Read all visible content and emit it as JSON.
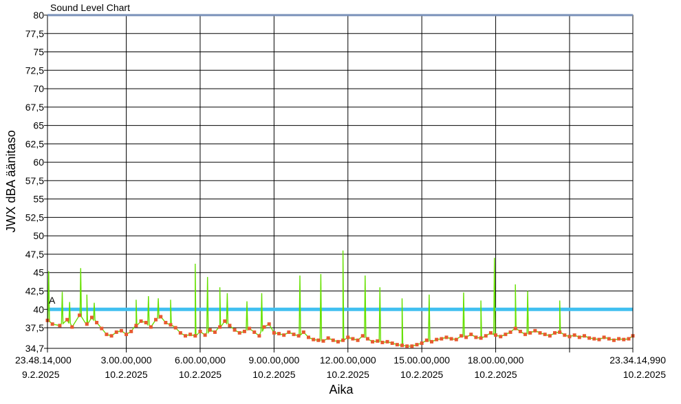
{
  "chart_data": {
    "type": "line",
    "title": "Sound Level Chart",
    "xlabel": "Aika",
    "ylabel": "JWX dBA äänitaso",
    "ylim": [
      34.7,
      80
    ],
    "y_ticks": [
      "80",
      "77,5",
      "75",
      "72,5",
      "70",
      "67,5",
      "65",
      "62,5",
      "60",
      "57,5",
      "55",
      "52,5",
      "50",
      "47,5",
      "45",
      "42,5",
      "40",
      "37,5",
      "34,7"
    ],
    "y_tick_values": [
      80,
      77.5,
      75,
      72.5,
      70,
      67.5,
      65,
      62.5,
      60,
      57.5,
      55,
      52.5,
      50,
      47.5,
      45,
      42.5,
      40,
      37.5,
      34.7
    ],
    "x_ticks": [
      {
        "time": "23.48.14,000",
        "date": "9.2.2025"
      },
      {
        "time": "3.00.00,000",
        "date": "10.2.2025"
      },
      {
        "time": "6.00.00,000",
        "date": "10.2.2025"
      },
      {
        "time": "9.00.00,000",
        "date": "10.2.2025"
      },
      {
        "time": "12.00.00,000",
        "date": "10.2.2025"
      },
      {
        "time": "15.00.00,000",
        "date": "10.2.2025"
      },
      {
        "time": "18.00.00,000",
        "date": "10.2.2025"
      },
      {
        "time": "",
        "date": ""
      },
      {
        "time": "23.34.14,990",
        "date": "10.2.2025"
      }
    ],
    "x_tick_hours": [
      0,
      3.2,
      6.2,
      9.2,
      12.2,
      15.2,
      18.2,
      21.2,
      23.77
    ],
    "threshold": {
      "value": 40,
      "color": "#40c0f0"
    },
    "marker_label": "A",
    "series": [
      {
        "color": "#66e000",
        "marker_color": "#e85a30",
        "points": [
          [
            0.0,
            38.5
          ],
          [
            0.2,
            38.0
          ],
          [
            0.5,
            37.8
          ],
          [
            0.8,
            38.6
          ],
          [
            1.0,
            37.6
          ],
          [
            1.3,
            39.2
          ],
          [
            1.6,
            38.0
          ],
          [
            1.8,
            38.9
          ],
          [
            2.0,
            38.2
          ],
          [
            2.2,
            37.4
          ],
          [
            2.4,
            36.6
          ],
          [
            2.6,
            36.4
          ],
          [
            2.8,
            36.9
          ],
          [
            3.0,
            37.1
          ],
          [
            3.2,
            36.6
          ],
          [
            3.4,
            37.0
          ],
          [
            3.6,
            37.8
          ],
          [
            3.8,
            38.4
          ],
          [
            4.0,
            38.2
          ],
          [
            4.2,
            37.6
          ],
          [
            4.4,
            38.6
          ],
          [
            4.6,
            39.0
          ],
          [
            4.8,
            38.2
          ],
          [
            5.0,
            37.9
          ],
          [
            5.2,
            37.5
          ],
          [
            5.4,
            36.8
          ],
          [
            5.6,
            36.4
          ],
          [
            5.8,
            36.6
          ],
          [
            6.0,
            36.4
          ],
          [
            6.2,
            37.0
          ],
          [
            6.4,
            36.5
          ],
          [
            6.6,
            37.2
          ],
          [
            6.8,
            36.9
          ],
          [
            7.0,
            37.6
          ],
          [
            7.2,
            38.4
          ],
          [
            7.4,
            37.8
          ],
          [
            7.6,
            37.2
          ],
          [
            7.8,
            36.8
          ],
          [
            8.0,
            37.0
          ],
          [
            8.2,
            37.4
          ],
          [
            8.4,
            36.9
          ],
          [
            8.6,
            36.4
          ],
          [
            8.8,
            37.6
          ],
          [
            9.0,
            38.0
          ],
          [
            9.2,
            36.8
          ],
          [
            9.4,
            36.7
          ],
          [
            9.6,
            36.5
          ],
          [
            9.8,
            36.9
          ],
          [
            10.0,
            36.6
          ],
          [
            10.2,
            36.4
          ],
          [
            10.4,
            36.9
          ],
          [
            10.6,
            36.2
          ],
          [
            10.8,
            35.9
          ],
          [
            11.0,
            35.8
          ],
          [
            11.2,
            35.7
          ],
          [
            11.4,
            36.1
          ],
          [
            11.6,
            35.8
          ],
          [
            11.8,
            35.6
          ],
          [
            12.0,
            35.8
          ],
          [
            12.2,
            36.2
          ],
          [
            12.4,
            36.0
          ],
          [
            12.6,
            35.8
          ],
          [
            12.8,
            36.4
          ],
          [
            13.0,
            36.0
          ],
          [
            13.2,
            35.6
          ],
          [
            13.4,
            35.7
          ],
          [
            13.6,
            35.5
          ],
          [
            13.8,
            35.6
          ],
          [
            14.0,
            35.4
          ],
          [
            14.2,
            35.2
          ],
          [
            14.4,
            35.1
          ],
          [
            14.6,
            35.0
          ],
          [
            14.8,
            35.0
          ],
          [
            15.0,
            35.2
          ],
          [
            15.2,
            35.4
          ],
          [
            15.4,
            35.8
          ],
          [
            15.6,
            35.6
          ],
          [
            15.8,
            35.9
          ],
          [
            16.0,
            36.0
          ],
          [
            16.2,
            36.2
          ],
          [
            16.4,
            36.0
          ],
          [
            16.6,
            35.9
          ],
          [
            16.8,
            36.4
          ],
          [
            17.0,
            36.2
          ],
          [
            17.2,
            36.6
          ],
          [
            17.4,
            36.2
          ],
          [
            17.6,
            36.1
          ],
          [
            17.8,
            36.4
          ],
          [
            18.0,
            36.8
          ],
          [
            18.2,
            36.5
          ],
          [
            18.4,
            36.3
          ],
          [
            18.6,
            36.6
          ],
          [
            18.8,
            36.9
          ],
          [
            19.0,
            37.4
          ],
          [
            19.2,
            37.0
          ],
          [
            19.4,
            36.6
          ],
          [
            19.6,
            36.8
          ],
          [
            19.8,
            37.1
          ],
          [
            20.0,
            36.8
          ],
          [
            20.2,
            36.6
          ],
          [
            20.4,
            36.4
          ],
          [
            20.6,
            36.8
          ],
          [
            20.8,
            36.9
          ],
          [
            21.0,
            36.5
          ],
          [
            21.2,
            36.3
          ],
          [
            21.4,
            36.5
          ],
          [
            21.6,
            36.2
          ],
          [
            21.8,
            36.4
          ],
          [
            22.0,
            36.1
          ],
          [
            22.2,
            36.0
          ],
          [
            22.4,
            35.9
          ],
          [
            22.6,
            36.2
          ],
          [
            22.8,
            36.0
          ],
          [
            23.0,
            35.8
          ],
          [
            23.2,
            36.0
          ],
          [
            23.4,
            35.9
          ],
          [
            23.6,
            36.0
          ],
          [
            23.77,
            36.4
          ]
        ]
      }
    ],
    "spikes": [
      [
        0.05,
        45.2
      ],
      [
        0.6,
        42.4
      ],
      [
        0.9,
        41.0
      ],
      [
        1.35,
        45.6
      ],
      [
        1.6,
        42.0
      ],
      [
        1.9,
        40.9
      ],
      [
        3.6,
        41.3
      ],
      [
        4.1,
        41.8
      ],
      [
        4.5,
        41.5
      ],
      [
        5.0,
        41.3
      ],
      [
        6.0,
        46.2
      ],
      [
        6.5,
        44.4
      ],
      [
        7.0,
        43.0
      ],
      [
        7.3,
        42.2
      ],
      [
        8.1,
        41.1
      ],
      [
        8.7,
        42.2
      ],
      [
        10.25,
        44.6
      ],
      [
        11.1,
        44.8
      ],
      [
        12.0,
        48.0
      ],
      [
        12.9,
        44.6
      ],
      [
        13.5,
        43.0
      ],
      [
        14.4,
        41.5
      ],
      [
        15.5,
        42.0
      ],
      [
        16.9,
        42.3
      ],
      [
        17.6,
        41.2
      ],
      [
        18.15,
        47.0
      ],
      [
        19.0,
        43.4
      ],
      [
        19.5,
        42.5
      ],
      [
        20.8,
        41.2
      ]
    ]
  }
}
